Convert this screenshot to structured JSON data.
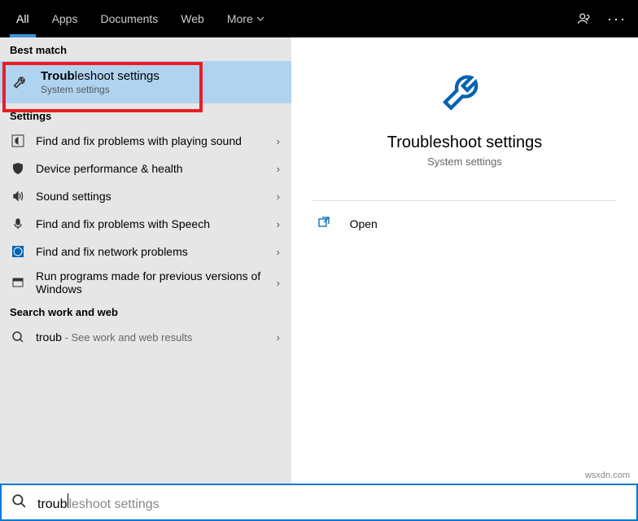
{
  "topbar": {
    "tabs": {
      "all": "All",
      "apps": "Apps",
      "documents": "Documents",
      "web": "Web",
      "more": "More"
    }
  },
  "sections": {
    "best_match": "Best match",
    "settings": "Settings",
    "search_web": "Search work and web"
  },
  "best": {
    "title_bold": "Troub",
    "title_rest": "leshoot settings",
    "subtitle": "System settings"
  },
  "settings_items": [
    {
      "label": "Find and fix problems with playing sound"
    },
    {
      "label": "Device performance & health"
    },
    {
      "label": "Sound settings"
    },
    {
      "label": "Find and fix problems with Speech"
    },
    {
      "label": "Find and fix network problems"
    },
    {
      "label": "Run programs made for previous versions of Windows"
    }
  ],
  "web_item": {
    "query": "troub",
    "suffix": " - See work and web results"
  },
  "preview": {
    "title": "Troubleshoot settings",
    "subtitle": "System settings",
    "open": "Open"
  },
  "search": {
    "typed": "troub",
    "ghost": "leshoot settings"
  },
  "watermark": "wsxdn.com"
}
